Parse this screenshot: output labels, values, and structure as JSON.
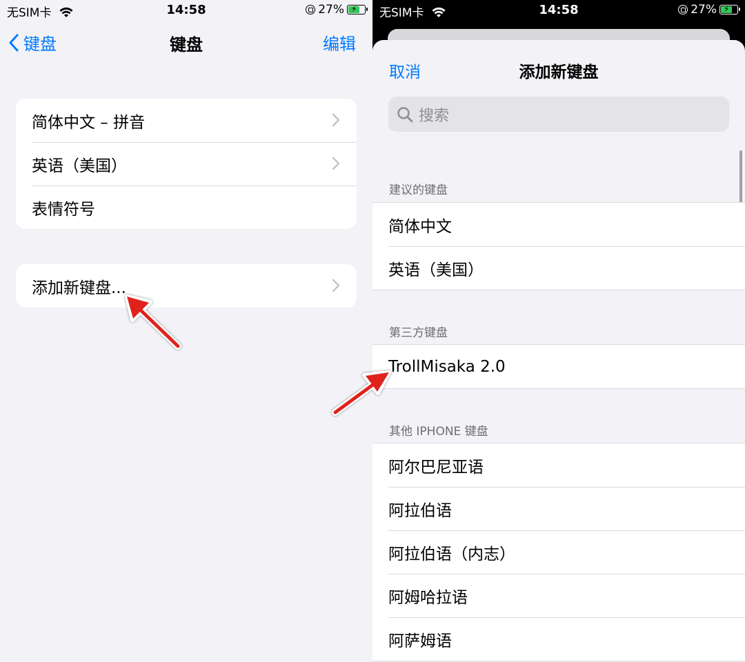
{
  "left": {
    "status": {
      "carrier": "无SIM卡",
      "time": "14:58",
      "battery": "27%"
    },
    "nav": {
      "back_label": "键盘",
      "title": "键盘",
      "edit_label": "编辑"
    },
    "keyboards": [
      "简体中文 – 拼音",
      "英语（美国）",
      "表情符号"
    ],
    "add_keyboard": "添加新键盘..."
  },
  "right": {
    "status": {
      "carrier": "无SIM卡",
      "time": "14:58",
      "battery": "27%"
    },
    "sheet": {
      "cancel_label": "取消",
      "title": "添加新键盘",
      "search_placeholder": "搜索"
    },
    "sections": [
      {
        "header": "建议的键盘",
        "items": [
          "简体中文",
          "英语（美国）"
        ]
      },
      {
        "header": "第三方键盘",
        "items": [
          "TrollMisaka 2.0"
        ]
      },
      {
        "header": "其他 IPHONE 键盘",
        "items": [
          "阿尔巴尼亚语",
          "阿拉伯语",
          "阿拉伯语（内志）",
          "阿姆哈拉语",
          "阿萨姆语"
        ]
      }
    ]
  },
  "colors": {
    "accent": "#007aff",
    "arrow": "#e0201b",
    "battery": "#34c759"
  }
}
